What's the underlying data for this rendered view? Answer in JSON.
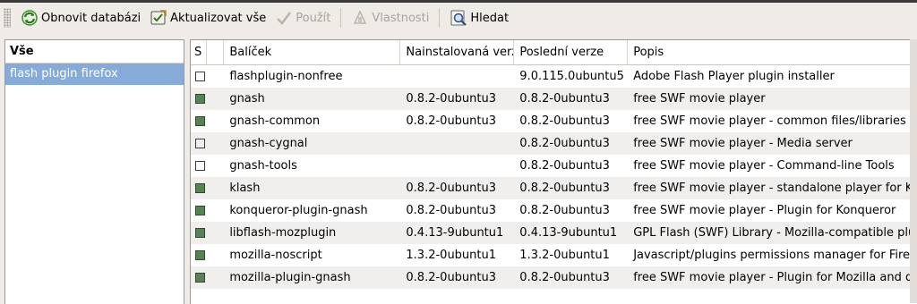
{
  "toolbar": {
    "reload": "Obnovit databázi",
    "upgrade": "Aktualizovat vše",
    "apply": "Použít",
    "properties": "Vlastnosti",
    "search": "Hledat"
  },
  "filter": {
    "header": "Vše",
    "selected": "flash plugin firefox"
  },
  "table": {
    "columns": {
      "status": "S",
      "package": "Balíček",
      "installed": "Nainstalovaná verz",
      "latest": "Poslední verze",
      "description": "Popis"
    },
    "rows": [
      {
        "installed_flag": false,
        "package": "flashplugin-nonfree",
        "installed": "",
        "latest": "9.0.115.0ubuntu5",
        "description": "Adobe Flash Player plugin installer"
      },
      {
        "installed_flag": true,
        "package": "gnash",
        "installed": "0.8.2-0ubuntu3",
        "latest": "0.8.2-0ubuntu3",
        "description": "free SWF movie player"
      },
      {
        "installed_flag": true,
        "package": "gnash-common",
        "installed": "0.8.2-0ubuntu3",
        "latest": "0.8.2-0ubuntu3",
        "description": "free SWF movie player - common files/libraries"
      },
      {
        "installed_flag": false,
        "package": "gnash-cygnal",
        "installed": "",
        "latest": "0.8.2-0ubuntu3",
        "description": "free SWF movie player - Media server"
      },
      {
        "installed_flag": false,
        "package": "gnash-tools",
        "installed": "",
        "latest": "0.8.2-0ubuntu3",
        "description": "free SWF movie player - Command-line Tools"
      },
      {
        "installed_flag": true,
        "package": "klash",
        "installed": "0.8.2-0ubuntu3",
        "latest": "0.8.2-0ubuntu3",
        "description": "free SWF movie player - standalone player for K"
      },
      {
        "installed_flag": true,
        "package": "konqueror-plugin-gnash",
        "installed": "0.8.2-0ubuntu3",
        "latest": "0.8.2-0ubuntu3",
        "description": "free SWF movie player - Plugin for Konqueror"
      },
      {
        "installed_flag": true,
        "package": "libflash-mozplugin",
        "installed": "0.4.13-9ubuntu1",
        "latest": "0.4.13-9ubuntu1",
        "description": "GPL Flash (SWF) Library - Mozilla-compatible plu"
      },
      {
        "installed_flag": true,
        "package": "mozilla-noscript",
        "installed": "1.3.2-0ubuntu1",
        "latest": "1.3.2-0ubuntu1",
        "description": "Javascript/plugins permissions manager for Fire"
      },
      {
        "installed_flag": true,
        "package": "mozilla-plugin-gnash",
        "installed": "0.8.2-0ubuntu3",
        "latest": "0.8.2-0ubuntu3",
        "description": "free SWF movie player - Plugin for Mozilla and d"
      }
    ]
  },
  "colors": {
    "installed_check": "#5a8056",
    "selection": "#86abd9"
  }
}
